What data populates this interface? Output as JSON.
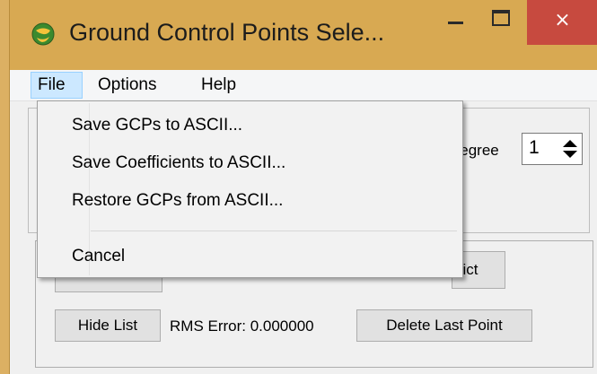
{
  "window": {
    "title": "Ground Control Points Sele...",
    "controls": {
      "minimize": "minimize",
      "maximize": "maximize",
      "close": "×"
    },
    "icon": "globe-app-icon"
  },
  "menubar": {
    "items": [
      {
        "label": "File",
        "active": true
      },
      {
        "label": "Options"
      },
      {
        "label": "Help"
      }
    ]
  },
  "file_menu": {
    "items": [
      {
        "label": "Save GCPs to ASCII..."
      },
      {
        "label": "Save Coefficients to ASCII..."
      },
      {
        "label": "Restore GCPs from ASCII..."
      },
      {
        "label": "Cancel"
      }
    ]
  },
  "settings": {
    "degree_label": "Degree",
    "degree_value": "1"
  },
  "buttons": {
    "predict_visible_label": "dict",
    "hide_list": "Hide List",
    "delete_last_point": "Delete Last Point"
  },
  "status": {
    "rms_error": "RMS Error: 0.000000"
  },
  "colors": {
    "titlebar": "#d8a952",
    "close_button": "#c74a3f",
    "menu_highlight": "#cce8ff"
  }
}
